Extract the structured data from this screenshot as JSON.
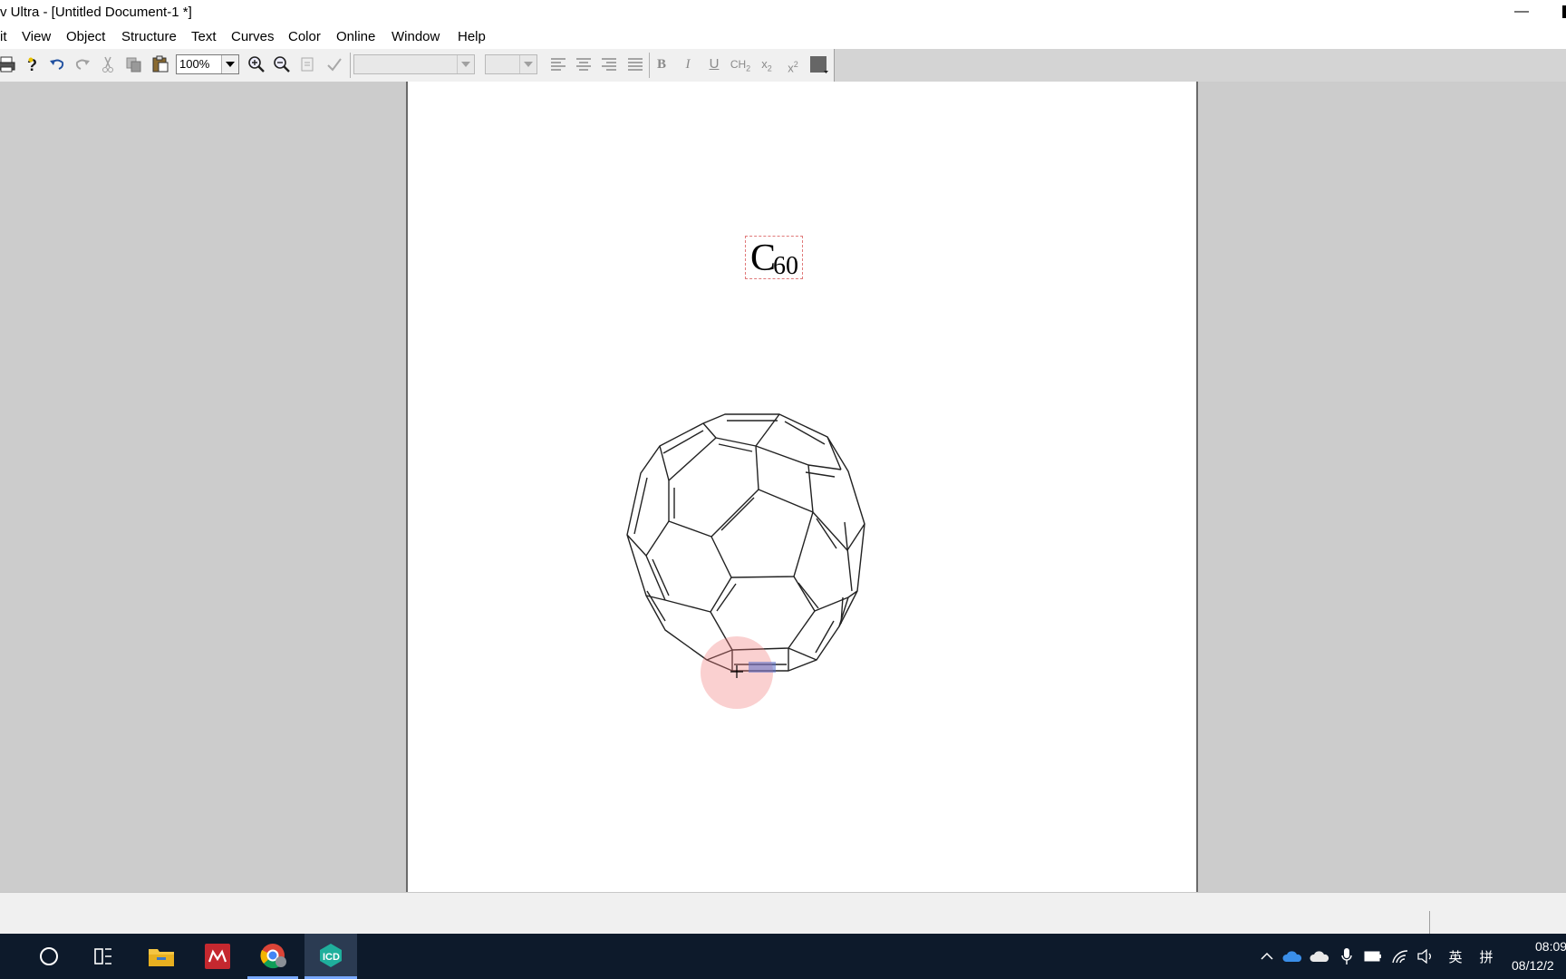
{
  "window": {
    "title": "v Ultra - [Untitled Document-1 *]",
    "minimize_glyph": "—"
  },
  "menu": [
    "it",
    "View",
    "Object",
    "Structure",
    "Text",
    "Curves",
    "Color",
    "Online",
    "Window",
    "Help"
  ],
  "toolbar": {
    "zoom_value": "100%",
    "icons": [
      "print-icon",
      "help-icon",
      "undo-icon",
      "redo-icon",
      "cut-icon",
      "copy-icon",
      "paste-icon",
      "zoom-in-icon",
      "zoom-out-icon",
      "show-stereo-icon",
      "check-structure-icon"
    ],
    "format": {
      "bold": "B",
      "italic": "I",
      "underline": "U",
      "formula": "CH",
      "formula_sub": "2",
      "subscript": "x",
      "subscript_sub": "2",
      "superscript": "x",
      "superscript_sup": "2"
    }
  },
  "document": {
    "label_main": "C",
    "label_sub": "60"
  },
  "taskbar": {
    "apps": [
      "search-icon",
      "task-view-icon",
      "file-explorer-icon",
      "mendeley-icon",
      "chrome-icon",
      "chemdraw-icon"
    ],
    "tray_ime": "英",
    "tray_ime2": "拼",
    "time": "08:09",
    "date": "08/12/2"
  },
  "colors": {
    "workspace": "#cccccc",
    "taskbar": "#0d1a2b",
    "cursor_halo": "#f07878",
    "selection": "#5a6ec8"
  }
}
